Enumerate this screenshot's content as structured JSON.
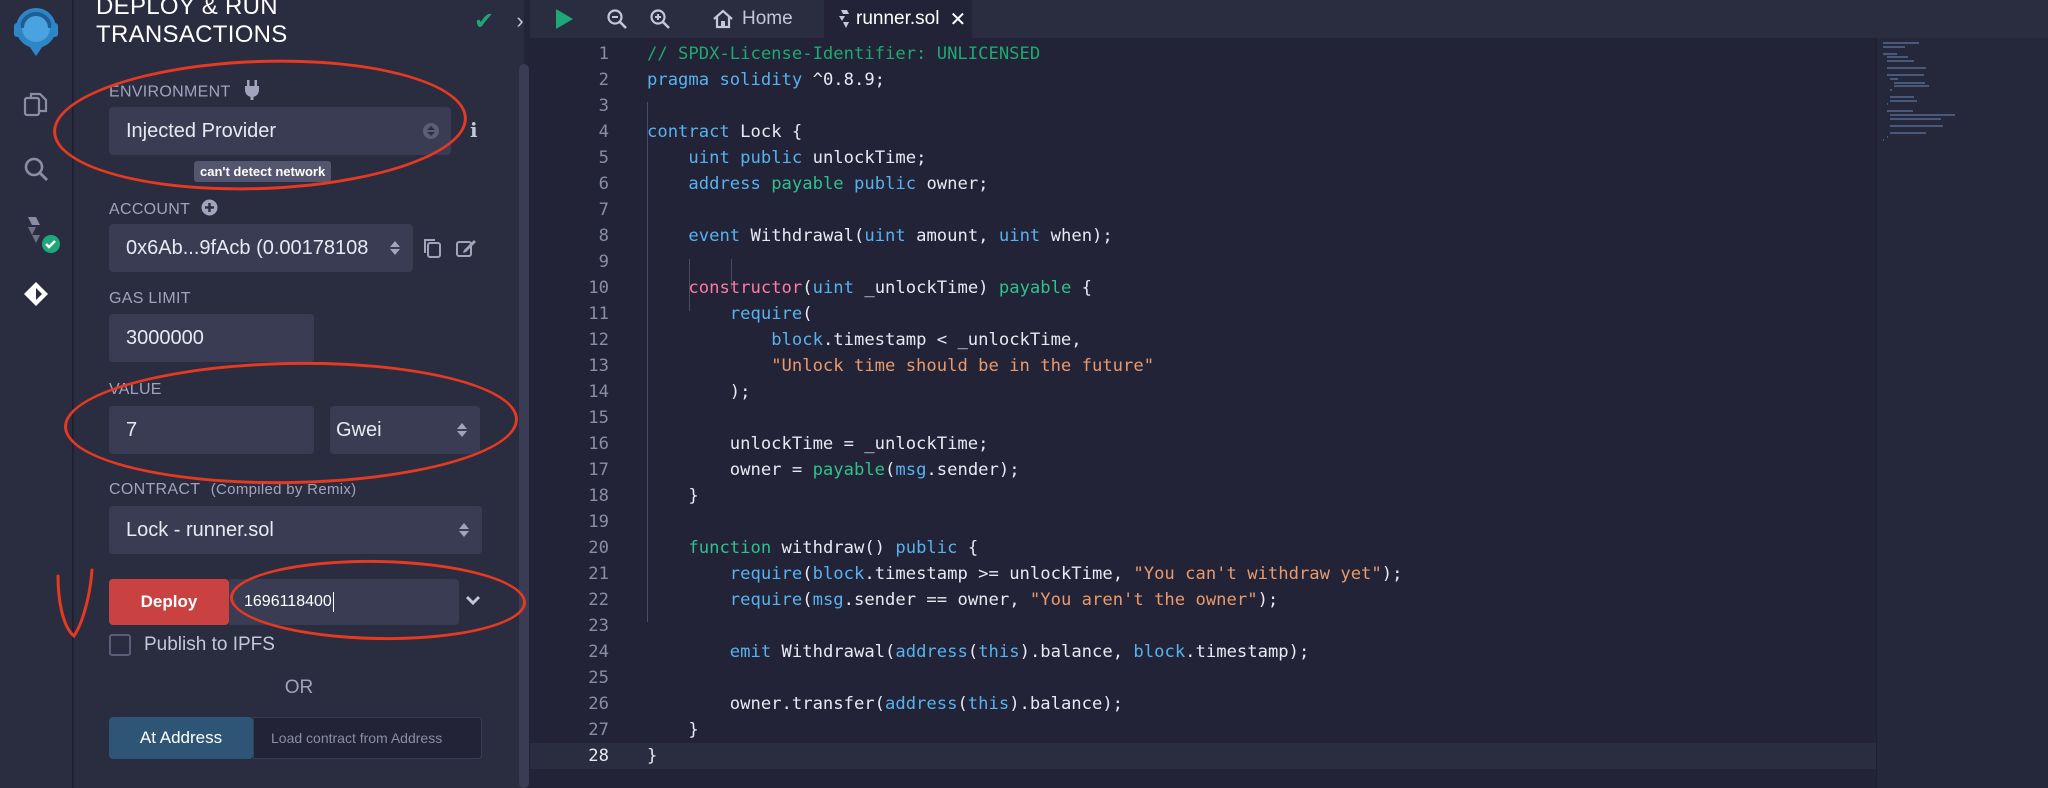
{
  "panel": {
    "title": "DEPLOY & RUN TRANSACTIONS",
    "environment_label": "ENVIRONMENT",
    "environment_value": "Injected Provider",
    "network_tooltip": "can't detect network",
    "account_label": "ACCOUNT",
    "account_value": "0x6Ab...9fAcb (0.00178108",
    "gas_limit_label": "GAS LIMIT",
    "gas_limit_value": "3000000",
    "value_label": "VALUE",
    "value_amount": "7",
    "value_unit": "Gwei",
    "contract_label": "CONTRACT",
    "contract_sublabel": "(Compiled by Remix)",
    "contract_value": "Lock - runner.sol",
    "deploy_label": "Deploy",
    "deploy_arg_value": "1696118400",
    "publish_label": "Publish to IPFS",
    "or_label": "OR",
    "at_address_label": "At Address",
    "load_address_placeholder": "Load contract from Address"
  },
  "tabs": [
    {
      "label": "Home"
    },
    {
      "label": "runner.sol"
    }
  ],
  "editor": {
    "current_line": 28,
    "lines": [
      {
        "n": "1",
        "html": "<span class=\"cm\">// SPDX-License-Identifier: UNLICENSED</span>"
      },
      {
        "n": "2",
        "html": "<span class=\"k1\">pragma</span> <span class=\"k1\">solidity</span> ^0.8.9;"
      },
      {
        "n": "3",
        "html": ""
      },
      {
        "n": "4",
        "html": "<span class=\"k1\">contract</span> Lock {"
      },
      {
        "n": "5",
        "html": "    <span class=\"k1\">uint</span> <span class=\"k1\">public</span> unlockTime;"
      },
      {
        "n": "6",
        "html": "    <span class=\"k1\">address</span> <span class=\"k2\">payable</span> <span class=\"k1\">public</span> owner;"
      },
      {
        "n": "7",
        "html": ""
      },
      {
        "n": "8",
        "html": "    <span class=\"k1\">event</span> Withdrawal(<span class=\"k1\">uint</span> amount, <span class=\"k1\">uint</span> when);"
      },
      {
        "n": "9",
        "html": ""
      },
      {
        "n": "10",
        "html": "    <span class=\"k3\">constructor</span>(<span class=\"k1\">uint</span> _unlockTime) <span class=\"k2\">payable</span> {"
      },
      {
        "n": "11",
        "html": "        <span class=\"k1\">require</span>("
      },
      {
        "n": "12",
        "html": "            <span class=\"k1\">block</span>.timestamp &lt; _unlockTime,"
      },
      {
        "n": "13",
        "html": "            <span class=\"str\">\"Unlock time should be in the future\"</span>"
      },
      {
        "n": "14",
        "html": "        );"
      },
      {
        "n": "15",
        "html": ""
      },
      {
        "n": "16",
        "html": "        unlockTime = _unlockTime;"
      },
      {
        "n": "17",
        "html": "        owner = <span class=\"k2\">payable</span>(<span class=\"k1\">msg</span>.sender);"
      },
      {
        "n": "18",
        "html": "    }"
      },
      {
        "n": "19",
        "html": ""
      },
      {
        "n": "20",
        "html": "    <span class=\"k2\">function</span> withdraw() <span class=\"k1\">public</span> {"
      },
      {
        "n": "21",
        "html": "        <span class=\"k1\">require</span>(<span class=\"k1\">block</span>.timestamp &gt;= unlockTime, <span class=\"str\">\"You can't withdraw yet\"</span>);"
      },
      {
        "n": "22",
        "html": "        <span class=\"k1\">require</span>(<span class=\"k1\">msg</span>.sender == owner, <span class=\"str\">\"You aren't the owner\"</span>);"
      },
      {
        "n": "23",
        "html": ""
      },
      {
        "n": "24",
        "html": "        <span class=\"k1\">emit</span> Withdrawal(<span class=\"k1\">address</span>(<span class=\"k1\">this</span>).balance, <span class=\"k1\">block</span>.timestamp);"
      },
      {
        "n": "25",
        "html": ""
      },
      {
        "n": "26",
        "html": "        owner.transfer(<span class=\"k1\">address</span>(<span class=\"k1\">this</span>).balance);"
      },
      {
        "n": "27",
        "html": "    }"
      },
      {
        "n": "28",
        "html": "}"
      }
    ]
  },
  "colors": {
    "accent_green": "#1ea87a",
    "deploy_red": "#c94141",
    "at_address_blue": "#2f5576",
    "annotation_red": "#e43a22"
  },
  "icons": [
    "remix-logo-icon",
    "file-explorer-icon",
    "search-icon",
    "solidity-compiler-icon",
    "deploy-run-icon",
    "plug-icon",
    "info-icon",
    "plus-circle-icon",
    "copy-icon",
    "edit-icon",
    "chevron-down-icon",
    "play-icon",
    "zoom-out-icon",
    "zoom-in-icon",
    "home-icon",
    "solidity-file-icon",
    "close-icon"
  ]
}
